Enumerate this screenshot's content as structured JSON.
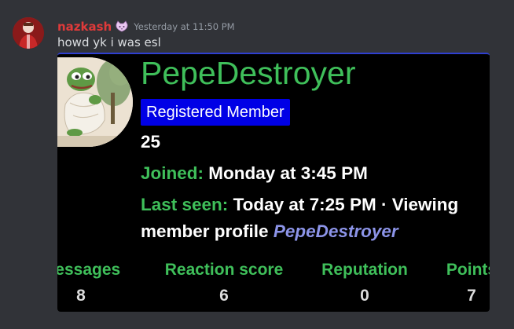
{
  "message": {
    "author": "nazkash",
    "timestamp": "Yesterday at 11:50 PM",
    "text": "howd yk i was esl"
  },
  "embed": {
    "name": "PepeDestroyer",
    "role": "Registered Member",
    "number": "25",
    "joined_label": "Joined:",
    "joined_value": "Monday at 3:45 PM",
    "last_seen_label": "Last seen:",
    "last_seen_value": "Today at 7:25 PM · Viewing",
    "last_seen_value2": "member profile",
    "last_seen_link": "PepeDestroyer",
    "stats": [
      {
        "label": "Messages",
        "value": "8"
      },
      {
        "label": "Reaction score",
        "value": "6"
      },
      {
        "label": "Reputation",
        "value": "0"
      },
      {
        "label": "Points",
        "value": "7"
      }
    ]
  },
  "colors": {
    "background": "#313338",
    "username": "#e03a3a",
    "accent_green": "#3fbf5a",
    "badge_blue": "#0000e6",
    "link": "#8c94e8"
  },
  "icons": {
    "role_icon": "cat-face-icon"
  }
}
